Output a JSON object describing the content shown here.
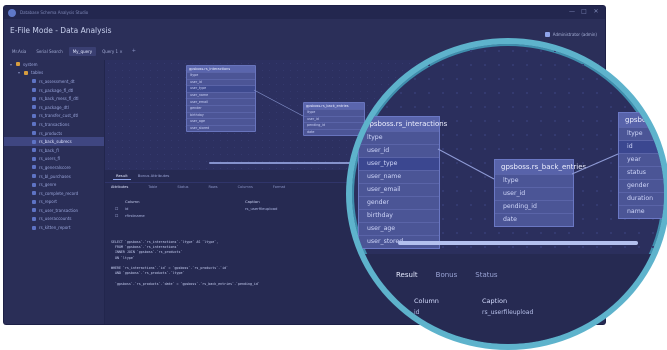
{
  "app": {
    "name": "Database Schema Analysis Studio"
  },
  "page_title": "E-File Mode - Data Analysis",
  "user": {
    "label": "Administrator (admin)"
  },
  "window_controls": [
    "—",
    "□",
    "✕"
  ],
  "tabs": [
    {
      "label": "Mr.Asia"
    },
    {
      "label": "Serial Search"
    },
    {
      "label": "My_query",
      "active": true
    },
    {
      "label": "Query 1 ×"
    }
  ],
  "tree": [
    {
      "label": "system",
      "kind": "db",
      "depth": 0,
      "chev": "▾"
    },
    {
      "label": "tables",
      "kind": "tables",
      "depth": 1,
      "chev": "▾"
    },
    {
      "label": "rs_assessment_dt",
      "depth": 2
    },
    {
      "label": "rs_package_fl_dtl",
      "depth": 2
    },
    {
      "label": "rs_back_mess_fl_dtl",
      "depth": 2
    },
    {
      "label": "rs_package_dtl",
      "depth": 2
    },
    {
      "label": "rs_transfer_cust_dtl",
      "depth": 2
    },
    {
      "label": "rs_transactions",
      "depth": 2
    },
    {
      "label": "rs_products",
      "depth": 2
    },
    {
      "label": "rs_back_subrecs",
      "depth": 2,
      "selected": true
    },
    {
      "label": "rs_back_fl",
      "depth": 2
    },
    {
      "label": "rs_users_fl",
      "depth": 2
    },
    {
      "label": "rs_generalscore",
      "depth": 2
    },
    {
      "label": "rs_bl_purchases",
      "depth": 2
    },
    {
      "label": "rs_genre",
      "depth": 2
    },
    {
      "label": "rs_complete_record",
      "depth": 2
    },
    {
      "label": "rs_report",
      "depth": 2
    },
    {
      "label": "rs_user_transaction",
      "depth": 2
    },
    {
      "label": "rs_useraccounts",
      "depth": 2
    },
    {
      "label": "rs_kitten_report",
      "depth": 2
    }
  ],
  "entities": {
    "users": {
      "title": "gpsboss.rs_interactions",
      "rows": [
        "ltype",
        "user_id",
        "user_type",
        "user_name",
        "user_email",
        "gender",
        "birthday",
        "user_age",
        "user_stored"
      ]
    },
    "mid": {
      "title": "gpsboss.rs_back_entries",
      "rows": [
        "ltype",
        "user_id",
        "pending_id",
        "date"
      ]
    },
    "right": {
      "title": "gpsboss.rs_",
      "rows": [
        "ltype",
        "id",
        "year",
        "status",
        "gender",
        "duration",
        "name"
      ]
    }
  },
  "results": {
    "tabs": [
      {
        "label": "Result",
        "active": true
      },
      {
        "label": "Bonus Attributes"
      }
    ],
    "subbar": [
      "Attributes",
      "Table",
      "Status",
      "Rows",
      "Columns",
      "Format"
    ],
    "columns": [
      "Column",
      "Caption"
    ],
    "rows": [
      {
        "col": "id",
        "caption": "rs_userfileupload"
      },
      {
        "col": "rfirstname",
        "caption": ""
      }
    ],
    "code": [
      "SELECT `gpsboss`.`rs_interactions`.`ltype` AS `ltype`,",
      "  FROM `gpsboss`.`rs_interactions`",
      "  INNER JOIN `gpsboss`.`rs_products`",
      "  ON `ltype`",
      "",
      "WHERE `rs_interactions`.`id` = `gpsboss`.`rs_products`.`id`",
      "  AND `gpsboss`.`rs_products`.`ltype`",
      "",
      "  `gpsboss`.`rs_products`.`date` = `gpsboss`.`rs_back_entries`.`pending_id`"
    ]
  },
  "lens": {
    "tabs": [
      "Result",
      "Bonus",
      "Status"
    ],
    "columns": [
      "Column",
      "Caption"
    ],
    "row": {
      "col": "id",
      "caption": "rs_userfileupload"
    }
  }
}
